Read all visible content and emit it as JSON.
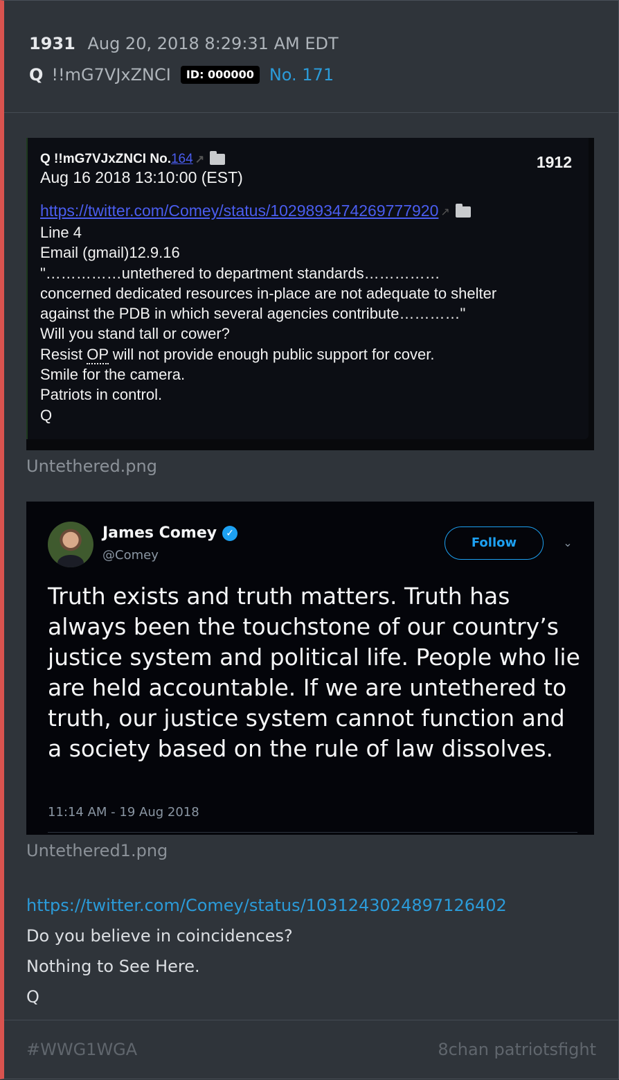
{
  "post": {
    "number": "1931",
    "timestamp": "Aug 20, 2018 8:29:31 AM EDT",
    "author": "Q",
    "tripcode": "!!mG7VJxZNCI",
    "id_badge": "ID: 000000",
    "post_no": "No. 171"
  },
  "image1": {
    "header": "Q !!mG7VJxZNCI No.",
    "ref_link": "164",
    "date": "Aug 16 2018 13:10:00 (EST)",
    "number": "1912",
    "url": "https://twitter.com/Comey/status/1029893474269777920",
    "lines": [
      "Line 4",
      "Email (gmail)12.9.16",
      "\"……………untethered to department standards……………",
      "concerned dedicated resources in-place are not adequate to shelter",
      "against the PDB in which several agencies contribute…………\"",
      "Will you stand tall or cower?"
    ],
    "resist_prefix": "Resist ",
    "resist_op": "OP",
    "resist_suffix": " will not provide enough public support for cover.",
    "lines2": [
      "Smile for the camera.",
      "Patriots in control.",
      "Q"
    ],
    "caption": "Untethered.png"
  },
  "image2": {
    "name": "James Comey",
    "handle": "@Comey",
    "follow_label": "Follow",
    "tweet_text": "Truth exists and truth matters. Truth has always been the touchstone of our country’s justice system and political life. People who lie are held accountable. If we are untethered to truth, our justice system cannot function and a society based on the rule of law dissolves.",
    "time": "11:14 AM - 19 Aug 2018",
    "caption": "Untethered1.png"
  },
  "body": {
    "link": "https://twitter.com/Comey/status/1031243024897126402",
    "line1": "Do you believe in coincidences?",
    "line2": "Nothing to See Here.",
    "sign": "Q"
  },
  "footer": {
    "hashtag": "#WWG1WGA",
    "source": "8chan patriotsfight"
  },
  "colors": {
    "accent_border": "#d9534f",
    "link": "#2b9bd9",
    "twitter_blue": "#1da1f2"
  }
}
